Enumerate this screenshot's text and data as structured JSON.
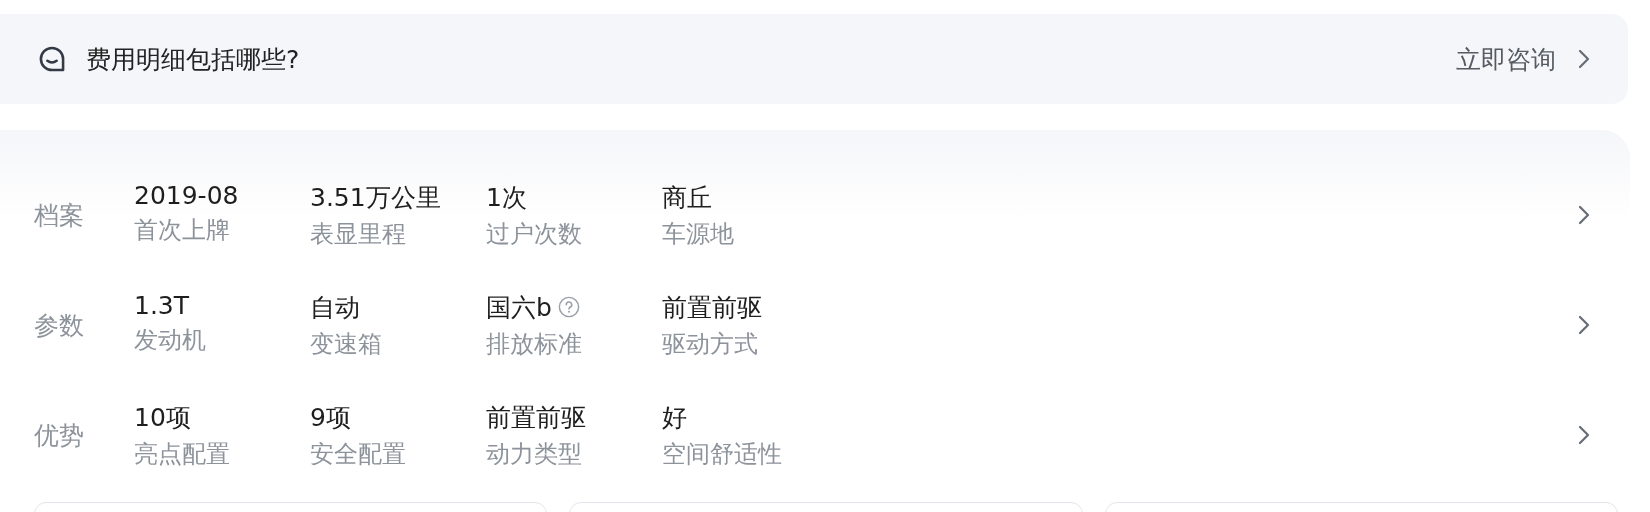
{
  "question_bar": {
    "text": "费用明细包括哪些?",
    "action": "立即咨询"
  },
  "rows": [
    {
      "title": "档案",
      "items": [
        {
          "value": "2019-08",
          "label": "首次上牌",
          "help": false
        },
        {
          "value": "3.51万公里",
          "label": "表显里程",
          "help": false
        },
        {
          "value": "1次",
          "label": "过户次数",
          "help": false
        },
        {
          "value": "商丘",
          "label": "车源地",
          "help": false
        }
      ]
    },
    {
      "title": "参数",
      "items": [
        {
          "value": "1.3T",
          "label": "发动机",
          "help": false
        },
        {
          "value": "自动",
          "label": "变速箱",
          "help": false
        },
        {
          "value": "国六b",
          "label": "排放标准",
          "help": true
        },
        {
          "value": "前置前驱",
          "label": "驱动方式",
          "help": false
        }
      ]
    },
    {
      "title": "优势",
      "items": [
        {
          "value": "10项",
          "label": "亮点配置",
          "help": false
        },
        {
          "value": "9项",
          "label": "安全配置",
          "help": false
        },
        {
          "value": "前置前驱",
          "label": "动力类型",
          "help": false
        },
        {
          "value": "好",
          "label": "空间舒适性",
          "help": false
        }
      ]
    }
  ]
}
